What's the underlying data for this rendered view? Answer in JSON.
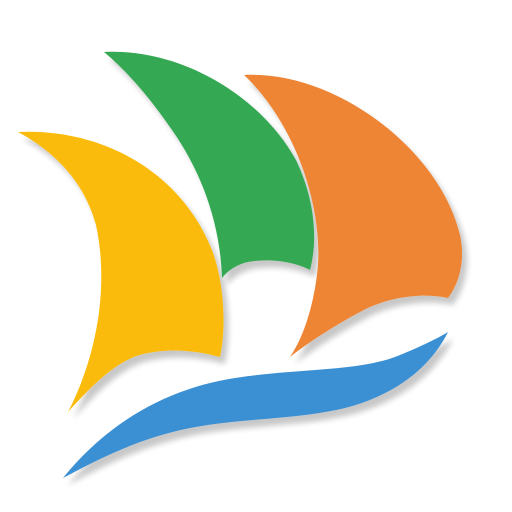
{
  "logo": {
    "name": "sailboat-logo",
    "colors": {
      "background": "#ffffff",
      "sail_yellow": "#FBBB07",
      "sail_green": "#34A853",
      "sail_orange": "#EE8536",
      "wave_blue": "#3A8FD3"
    }
  }
}
